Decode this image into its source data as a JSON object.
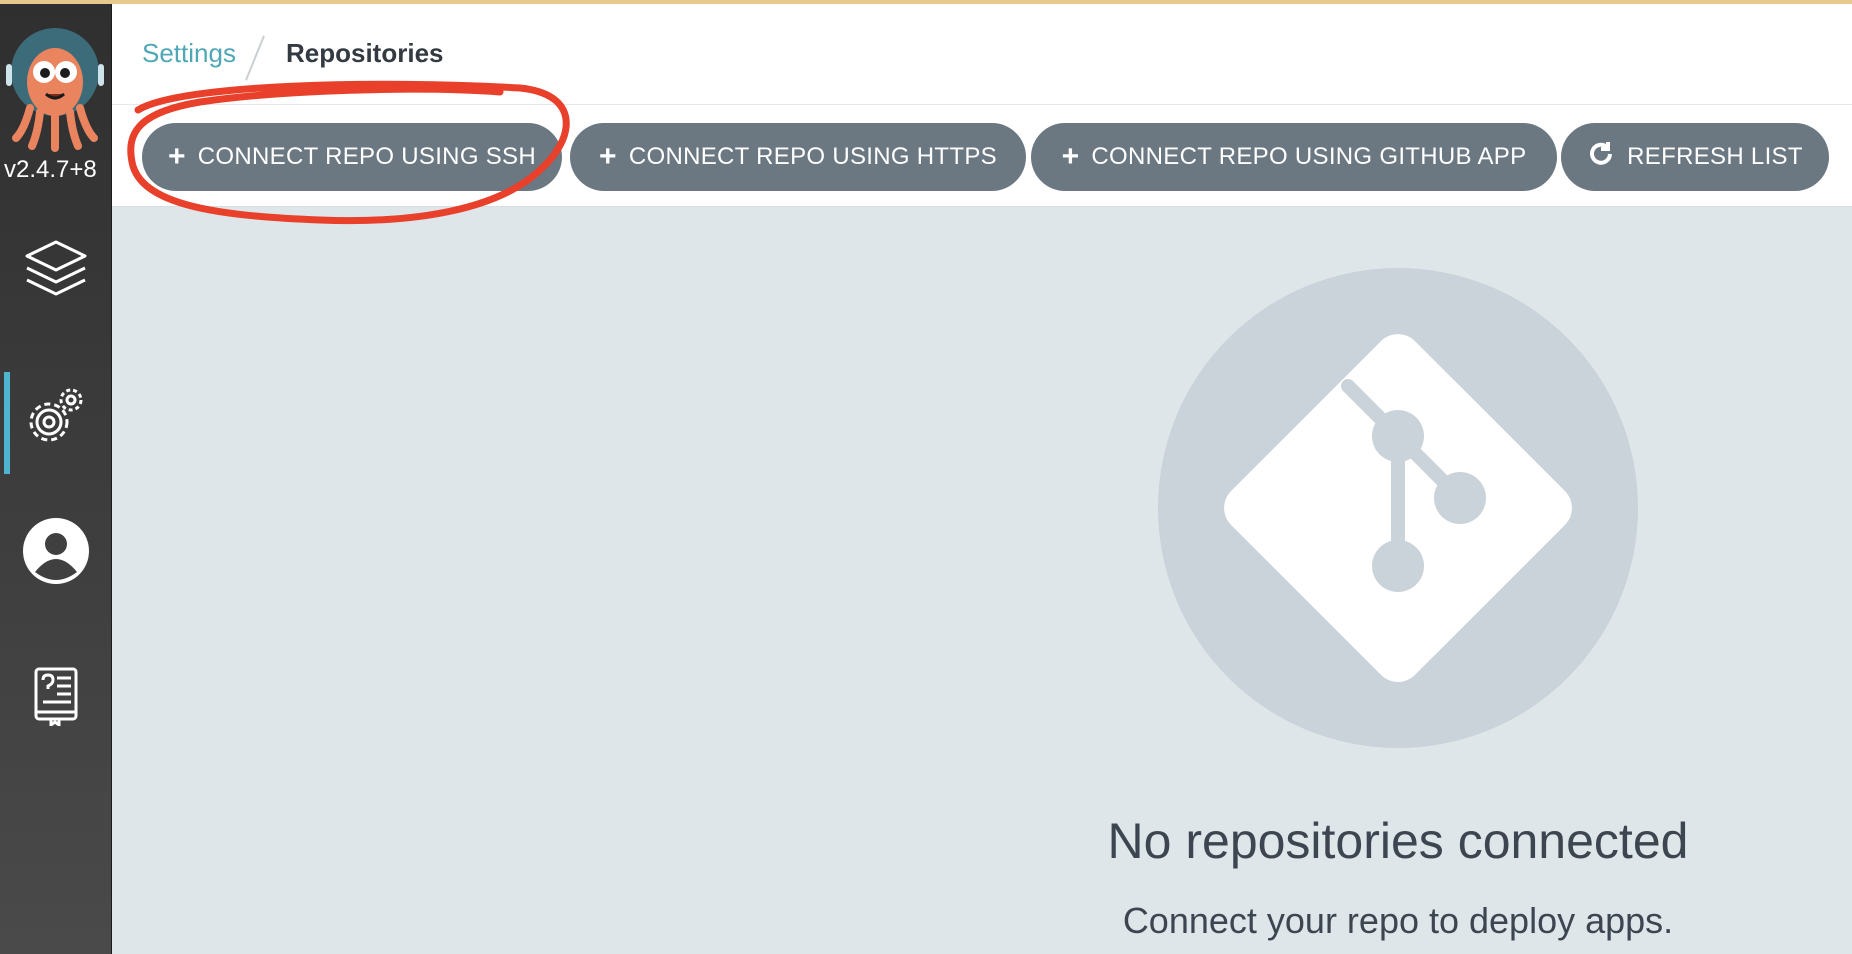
{
  "app": {
    "version": "v2.4.7+8",
    "accent": "#4fb4d1"
  },
  "breadcrumb": {
    "parent": "Settings",
    "current": "Repositories"
  },
  "sidebar": {
    "items": [
      {
        "icon": "layers-icon"
      },
      {
        "icon": "gear-icon",
        "active": true
      },
      {
        "icon": "user-icon"
      },
      {
        "icon": "docs-icon"
      }
    ]
  },
  "toolbar": {
    "connect_ssh": "CONNECT REPO USING SSH",
    "connect_https": "CONNECT REPO USING HTTPS",
    "connect_github_app": "CONNECT REPO USING GITHUB APP",
    "refresh": "REFRESH LIST"
  },
  "empty_state": {
    "title": "No repositories connected",
    "subtitle": "Connect your repo to deploy apps.",
    "icon": "git-icon"
  }
}
